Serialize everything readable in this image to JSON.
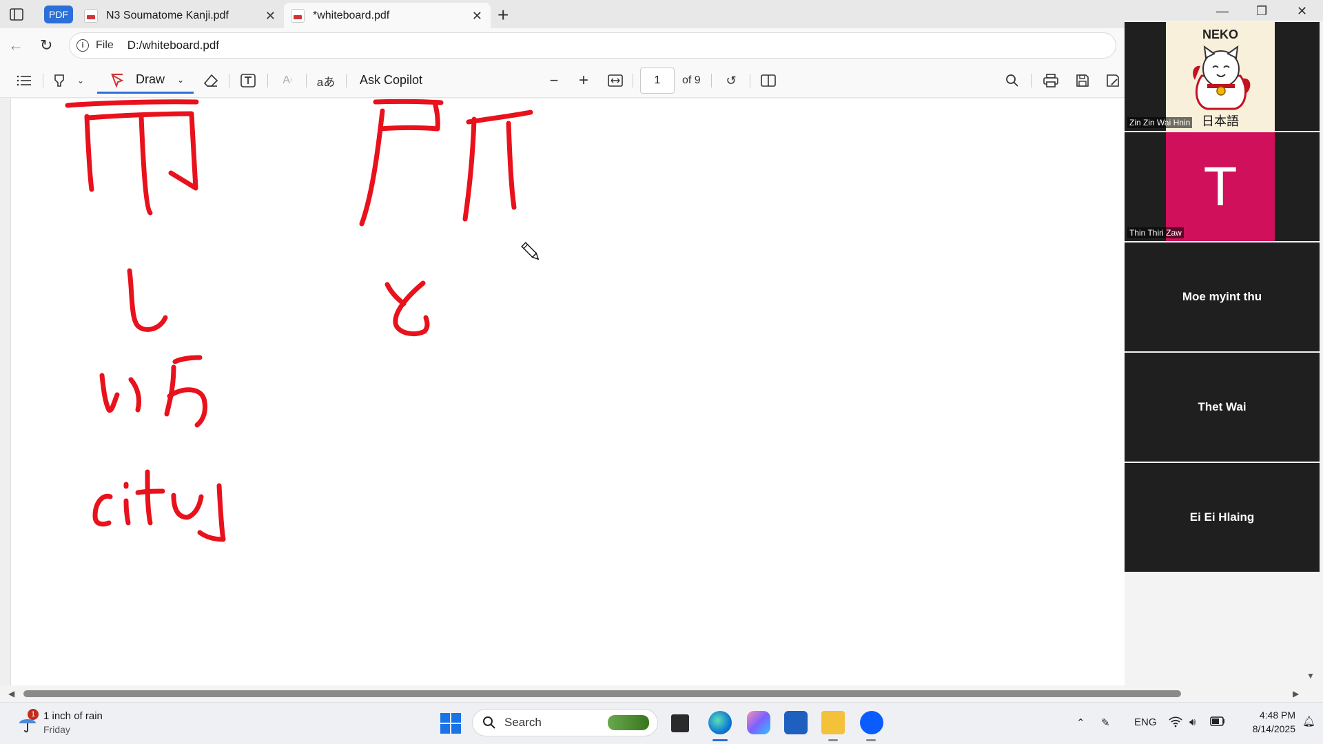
{
  "browser": {
    "tabs": [
      {
        "title": "N3 Soumatome Kanji.pdf",
        "active": false
      },
      {
        "title": "*whiteboard.pdf",
        "active": true
      }
    ],
    "pdf_badge": "PDF",
    "address": {
      "scheme_label": "File",
      "url": "D:/whiteboard.pdf"
    }
  },
  "pdf_toolbar": {
    "draw_label": "Draw",
    "copilot_label": "Ask Copilot",
    "read_aloud_glyph": "aあ",
    "page_current": "1",
    "page_total_label": "of 9"
  },
  "ink_words": [
    "city"
  ],
  "zoom": {
    "participants": [
      {
        "name": "Zin Zin Wai Hnin",
        "tile": "image",
        "image_brand": "NEKO",
        "image_caption": "日本語"
      },
      {
        "name": "Thin Thiri Zaw",
        "tile": "avatar",
        "initial": "T",
        "color": "#d0105a"
      },
      {
        "name": "Moe myint thu",
        "tile": "name"
      },
      {
        "name": "Thet Wai",
        "tile": "name"
      },
      {
        "name": "Ei Ei Hlaing",
        "tile": "name"
      }
    ]
  },
  "taskbar": {
    "weather_badge": "1",
    "weather_title": "1 inch of rain",
    "weather_sub": "Friday",
    "search_label": "Search",
    "language": "ENG",
    "time": "4:48 PM",
    "date": "8/14/2025"
  },
  "colors": {
    "ink": "#e8111c",
    "accent": "#2b6fd8"
  }
}
